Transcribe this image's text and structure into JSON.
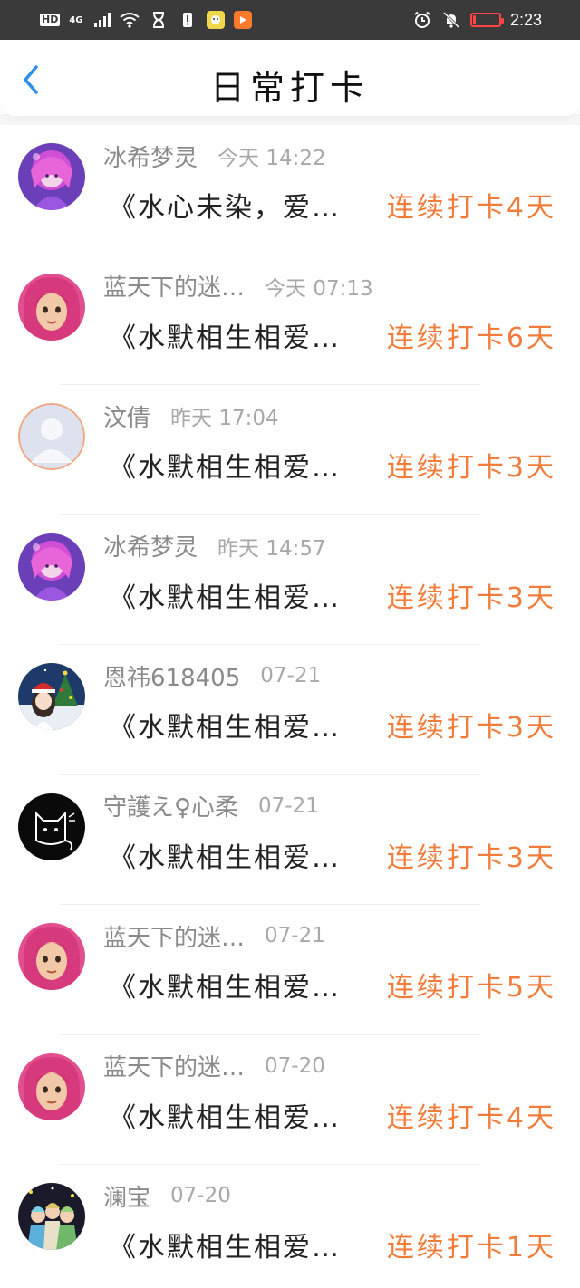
{
  "status_bar": {
    "hd": "HD",
    "network": "4G",
    "time": "2:23",
    "battery_level_percent": 10
  },
  "header": {
    "title": "日常打卡",
    "accent_color": "#2f8fe8"
  },
  "colors": {
    "streak": "#f07d3c",
    "name": "#8a8a8a"
  },
  "entries": [
    {
      "name": "冰希梦灵",
      "time": "今天 14:22",
      "quote": "《水心未染，爱…",
      "streak": "连续打卡4天",
      "avatar": "anime-girl-purple-avatar"
    },
    {
      "name": "蓝天下的迷…",
      "time": "今天 07:13",
      "quote": "《水默相生相爱…",
      "streak": "连续打卡6天",
      "avatar": "pink-hair-girl-avatar"
    },
    {
      "name": "汶倩",
      "time": "昨天 17:04",
      "quote": "《水默相生相爱…",
      "streak": "连续打卡3天",
      "avatar": "default-user-avatar"
    },
    {
      "name": "冰希梦灵",
      "time": "昨天 14:57",
      "quote": "《水默相生相爱…",
      "streak": "连续打卡3天",
      "avatar": "anime-girl-purple-avatar"
    },
    {
      "name": "恩祎618405",
      "time": "07-21",
      "quote": "《水默相生相爱…",
      "streak": "连续打卡3天",
      "avatar": "christmas-girl-avatar"
    },
    {
      "name": "守護え♀心柔",
      "time": "07-21",
      "quote": "《水默相生相爱…",
      "streak": "连续打卡3天",
      "avatar": "black-cat-avatar"
    },
    {
      "name": "蓝天下的迷…",
      "time": "07-21",
      "quote": "《水默相生相爱…",
      "streak": "连续打卡5天",
      "avatar": "pink-hair-girl-avatar"
    },
    {
      "name": "蓝天下的迷…",
      "time": "07-20",
      "quote": "《水默相生相爱…",
      "streak": "连续打卡4天",
      "avatar": "pink-hair-girl-avatar"
    },
    {
      "name": "澜宝",
      "time": "07-20",
      "quote": "《水默相生相爱…",
      "streak": "连续打卡1天",
      "avatar": "group-anime-avatar"
    }
  ]
}
